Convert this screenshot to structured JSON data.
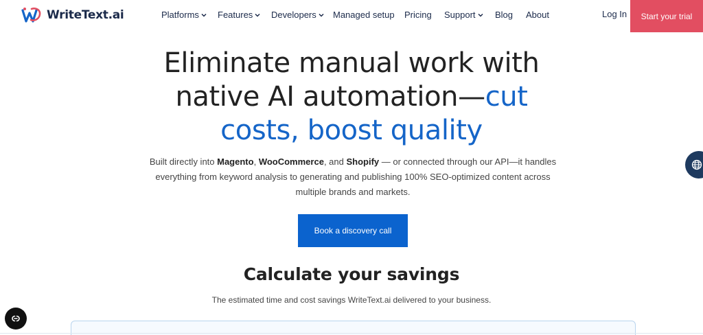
{
  "header": {
    "logo_text": "WriteText.ai",
    "nav": [
      {
        "label": "Platforms",
        "dropdown": true
      },
      {
        "label": "Features",
        "dropdown": true
      },
      {
        "label": "Developers",
        "dropdown": true
      },
      {
        "label": "Managed setup",
        "dropdown": false
      },
      {
        "label": "Pricing",
        "dropdown": false
      },
      {
        "label": "Support",
        "dropdown": true
      },
      {
        "label": "Blog",
        "dropdown": false
      },
      {
        "label": "About",
        "dropdown": false
      }
    ],
    "login_label": "Log In",
    "trial_label": "Start your trial"
  },
  "hero": {
    "title_line1": "Eliminate manual work with",
    "title_line2_plain": "native AI automation—",
    "title_line2_accent": "cut",
    "title_line3_accent": "costs, boost quality",
    "sub_prefix": "Built directly into ",
    "sub_magento": "Magento",
    "sub_comma1": ", ",
    "sub_woo": "WooCommerce",
    "sub_and": ", and ",
    "sub_shopify": "Shopify",
    "sub_rest_line1": " — or connected through our API—it handles",
    "sub_line2": "everything from keyword analysis to generating and publishing 100% SEO-optimized content across",
    "sub_line3": "multiple brands and markets.",
    "cta_label": "Book a discovery call"
  },
  "calculator": {
    "title": "Calculate your savings",
    "subtitle": "The estimated time and cost savings WriteText.ai delivered to your business."
  },
  "widgets": {
    "language_icon": "globe-icon",
    "cookie_icon": "cookie-settings-icon"
  },
  "colors": {
    "accent_blue": "#1565c8",
    "cta_blue": "#0b63ce",
    "trial_red": "#e24e61",
    "nav_text": "#1b2a4a",
    "widget_navy": "#1e3a5f"
  }
}
